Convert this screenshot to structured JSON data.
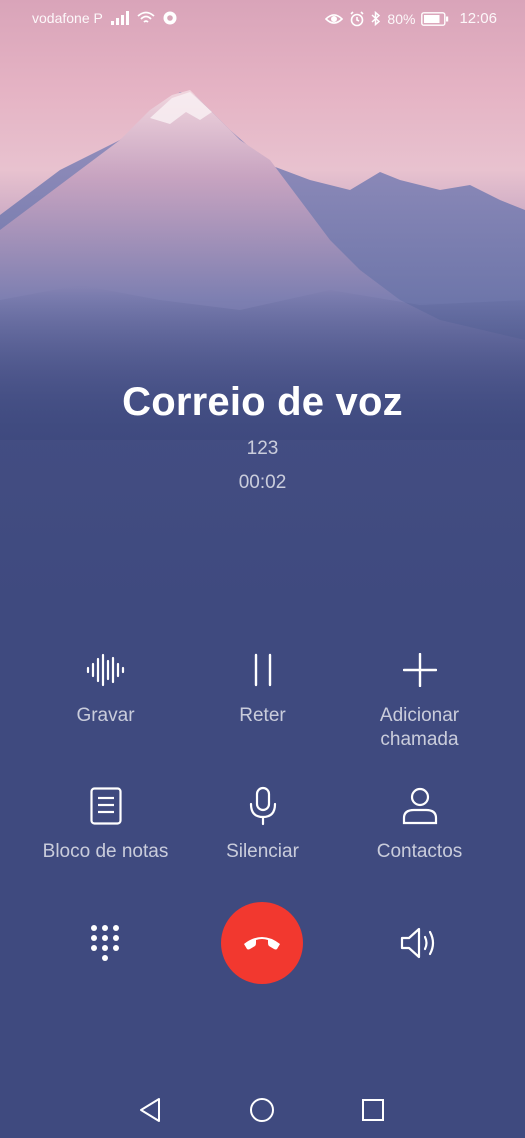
{
  "status_bar": {
    "carrier": "vodafone P",
    "battery_percent": "80%",
    "time": "12:06",
    "icons": [
      "signal-icon",
      "wifi-icon",
      "chrome-icon",
      "eye-icon",
      "alarm-icon",
      "bluetooth-icon",
      "battery-icon"
    ]
  },
  "call": {
    "name": "Correio de voz",
    "number": "123",
    "duration": "00:02"
  },
  "actions": {
    "record": {
      "label": "Gravar",
      "icon": "waveform-icon"
    },
    "hold": {
      "label": "Reter",
      "icon": "pause-icon"
    },
    "add_call": {
      "label_line1": "Adicionar",
      "label_line2": "chamada",
      "icon": "plus-icon"
    },
    "notepad": {
      "label": "Bloco de notas",
      "icon": "notes-icon"
    },
    "mute": {
      "label": "Silenciar",
      "icon": "microphone-icon"
    },
    "contacts": {
      "label": "Contactos",
      "icon": "person-icon"
    }
  },
  "controls": {
    "dialpad_icon": "dialpad-icon",
    "end_call_icon": "phone-hangup-icon",
    "end_call_color": "#f2382f",
    "speaker_icon": "speaker-icon"
  },
  "navigation": {
    "back_icon": "back-triangle-icon",
    "home_icon": "home-circle-icon",
    "recent_icon": "recent-square-icon"
  },
  "colors": {
    "background": "#3f4a7f",
    "sky_pink": "#e5b3c4",
    "text_secondary": "rgba(255,255,255,0.72)"
  }
}
